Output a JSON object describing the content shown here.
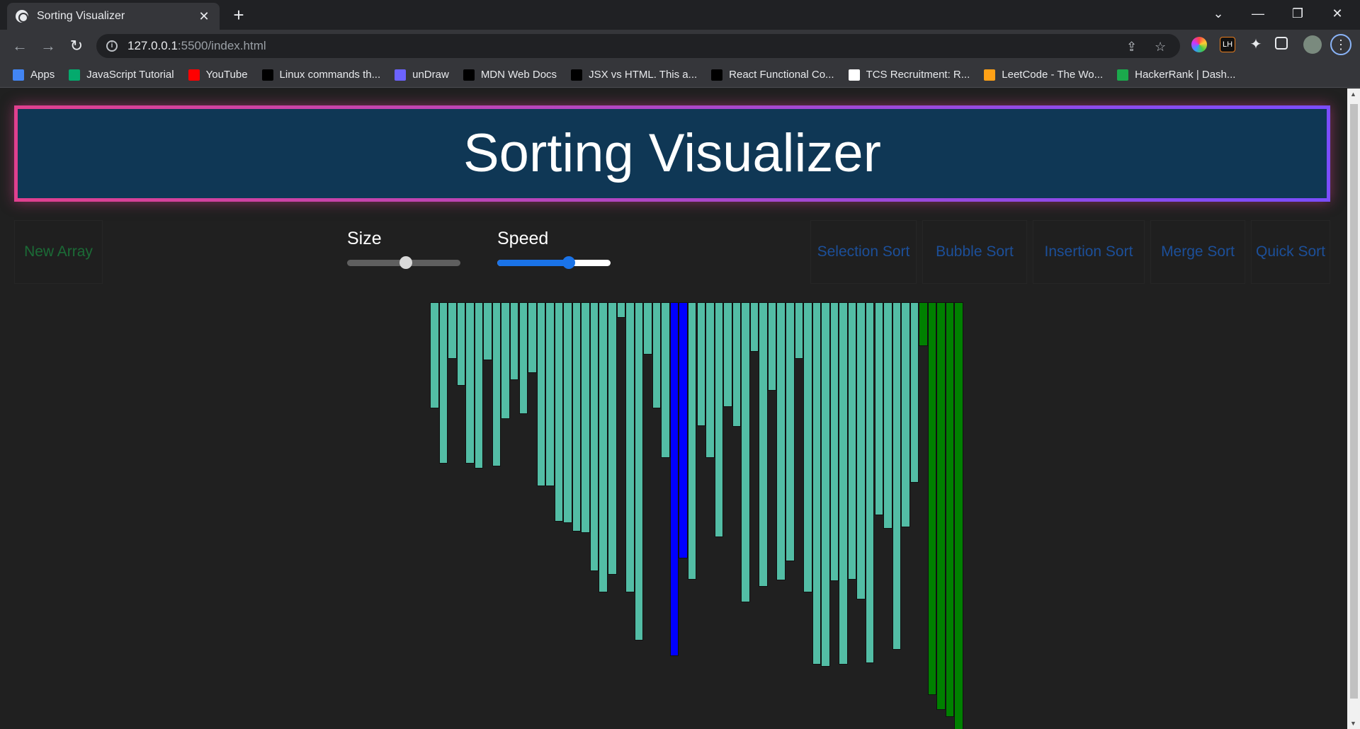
{
  "browser": {
    "tab_title": "Sorting Visualizer",
    "url_host": "127.0.0.1",
    "url_path": ":5500/index.html",
    "bookmarks": [
      {
        "label": "Apps",
        "icon": "apps-grid-icon",
        "color": "#4285f4"
      },
      {
        "label": "JavaScript Tutorial",
        "icon": "w3schools-icon",
        "color": "#04aa6d"
      },
      {
        "label": "YouTube",
        "icon": "youtube-icon",
        "color": "#ff0000"
      },
      {
        "label": "Linux commands th...",
        "icon": "dev-icon",
        "color": "#000000"
      },
      {
        "label": "unDraw",
        "icon": "undraw-icon",
        "color": "#6c63ff"
      },
      {
        "label": "MDN Web Docs",
        "icon": "mdn-icon",
        "color": "#000000"
      },
      {
        "label": "JSX vs HTML. This a...",
        "icon": "medium-icon",
        "color": "#000000"
      },
      {
        "label": "React Functional Co...",
        "icon": "medium-icon",
        "color": "#000000"
      },
      {
        "label": "TCS Recruitment: R...",
        "icon": "tcs-icon",
        "color": "#ffffff"
      },
      {
        "label": "LeetCode - The Wo...",
        "icon": "leetcode-icon",
        "color": "#ffa116"
      },
      {
        "label": "HackerRank | Dash...",
        "icon": "hackerrank-icon",
        "color": "#1ba94c"
      }
    ]
  },
  "page": {
    "title": "Sorting Visualizer",
    "new_array_label": "New Array",
    "size_label": "Size",
    "speed_label": "Speed",
    "size_value_fraction": 0.52,
    "speed_value_fraction": 0.63,
    "sort_buttons": [
      "Selection Sort",
      "Bubble Sort",
      "Insertion Sort",
      "Merge Sort",
      "Quick Sort"
    ]
  },
  "colors": {
    "header_bg": "#0f3755",
    "bar_default": "#53bda5",
    "bar_compare": "#0000ff",
    "bar_sorted": "#008000",
    "new_array_text": "#1b6b36",
    "sort_button_text": "#1c4f99"
  },
  "bar_heights": [
    150,
    228,
    80,
    118,
    228,
    235,
    82,
    232,
    165,
    110,
    158,
    100,
    260,
    260,
    310,
    312,
    324,
    326,
    380,
    410,
    385,
    22,
    410,
    478,
    74,
    150,
    220,
    500,
    362,
    392,
    175,
    220,
    332,
    148,
    176,
    424,
    70,
    402,
    125,
    393,
    366,
    80,
    410,
    512,
    515,
    394,
    512,
    392,
    420,
    510,
    301,
    320,
    491,
    318,
    255,
    62,
    555,
    576,
    586,
    605
  ],
  "bar_states": [
    "d",
    "d",
    "d",
    "d",
    "d",
    "d",
    "d",
    "d",
    "d",
    "d",
    "d",
    "d",
    "d",
    "d",
    "d",
    "d",
    "d",
    "d",
    "d",
    "d",
    "d",
    "d",
    "d",
    "d",
    "d",
    "d",
    "d",
    "c",
    "c",
    "d",
    "d",
    "d",
    "d",
    "d",
    "d",
    "d",
    "d",
    "d",
    "d",
    "d",
    "d",
    "d",
    "d",
    "d",
    "d",
    "d",
    "d",
    "d",
    "d",
    "d",
    "d",
    "d",
    "d",
    "d",
    "d",
    "s",
    "s",
    "s",
    "s",
    "s"
  ]
}
